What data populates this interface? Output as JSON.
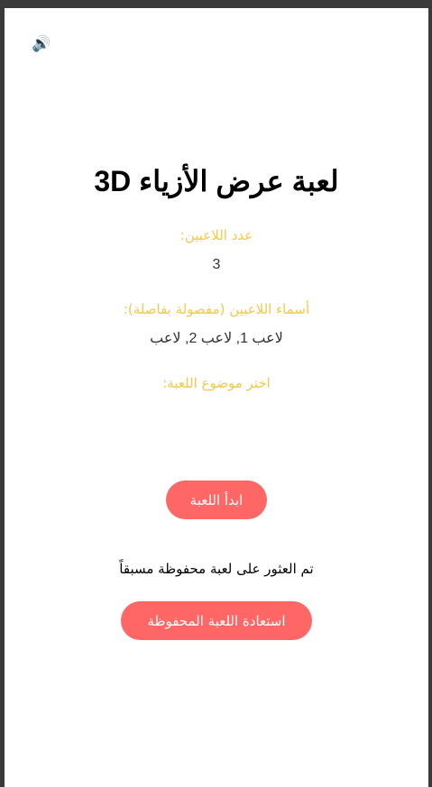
{
  "sound_toggle": {
    "icon": "speaker-icon",
    "glyph": "🔊"
  },
  "title": "لعبة عرض الأزياء 3D",
  "players_count": {
    "label": "عدد اللاعبين:",
    "value": "3"
  },
  "player_names": {
    "label": "أسماء اللاعبين (مفصولة بفاصلة):",
    "value": "لاعب 1, لاعب 2, لاعب"
  },
  "theme": {
    "label": "اختر موضوع اللعبة:"
  },
  "start_button": "ابدأ اللعبة",
  "saved_notice": "تم العثور على لعبة محفوظة مسبقاً",
  "restore_button": "استعادة اللعبة المحفوظة",
  "colors": {
    "accent": "#ff6666",
    "label": "#f2c94c"
  }
}
